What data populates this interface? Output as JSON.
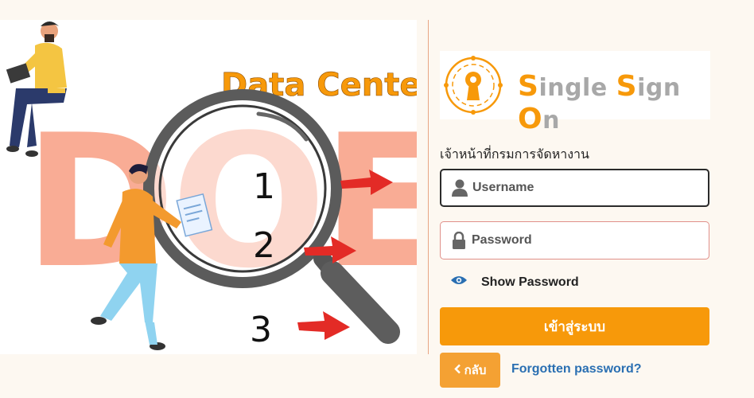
{
  "illustration": {
    "banner_text": "Data Center",
    "watermark_text": "DOE",
    "step_numbers": [
      "1",
      "2",
      "3"
    ]
  },
  "logo": {
    "title_parts": [
      {
        "text": "S",
        "color": "#f7990a"
      },
      {
        "text": "ingle ",
        "color": "#a8a8a8"
      },
      {
        "text": "S",
        "color": "#f7990a"
      },
      {
        "text": "ign ",
        "color": "#a8a8a8"
      },
      {
        "text": "O",
        "color": "#f7990a"
      },
      {
        "text": "n",
        "color": "#a8a8a8"
      }
    ]
  },
  "form": {
    "department_label": "เจ้าหน้าที่กรมการจัดหางาน",
    "username_placeholder": "Username",
    "username_value": "",
    "password_placeholder": "Password",
    "password_value": "",
    "show_password_label": "Show Password",
    "login_button": "เข้าสู่ระบบ",
    "back_button": "กลับ",
    "forgot_link": "Forgotten password?"
  },
  "icons": {
    "user": "user-icon",
    "lock": "lock-icon",
    "eye": "eye-icon",
    "chevron": "chevron-left-icon",
    "arrow": "red-arrow-icon"
  },
  "colors": {
    "accent": "#f7990a",
    "link": "#2a6fb2",
    "arrow": "#e32b26",
    "watermark": "#f9a890"
  }
}
